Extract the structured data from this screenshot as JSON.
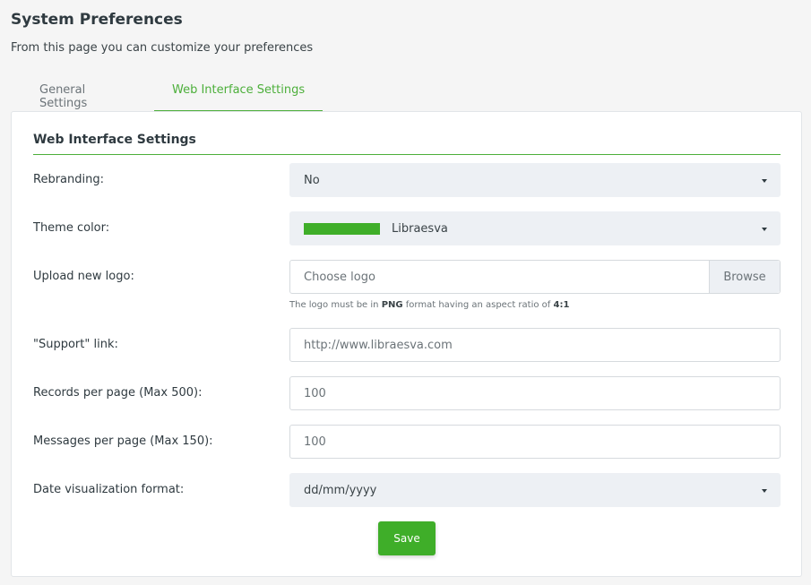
{
  "page": {
    "title": "System Preferences",
    "subtitle": "From this page you can customize your preferences"
  },
  "tabs": [
    {
      "label": "General Settings",
      "active": false
    },
    {
      "label": "Web Interface Settings",
      "active": true
    }
  ],
  "section": {
    "title": "Web Interface Settings"
  },
  "form": {
    "rebranding": {
      "label": "Rebranding:",
      "value": "No"
    },
    "theme_color": {
      "label": "Theme color:",
      "value": "Libraesva",
      "swatch_color": "#3fae29"
    },
    "logo": {
      "label": "Upload new logo:",
      "placeholder": "Choose logo",
      "browse_label": "Browse",
      "help_prefix": "The logo must be in ",
      "help_format": "PNG",
      "help_middle": " format having an aspect ratio of ",
      "help_ratio": "4:1"
    },
    "support_link": {
      "label": "\"Support\" link:",
      "value": "http://www.libraesva.com"
    },
    "records_per_page": {
      "label": "Records per page (Max 500):",
      "value": "100"
    },
    "messages_per_page": {
      "label": "Messages per page (Max 150):",
      "value": "100"
    },
    "date_format": {
      "label": "Date visualization format:",
      "value": "dd/mm/yyyy"
    }
  },
  "actions": {
    "save_label": "Save"
  },
  "colors": {
    "accent": "#4caf3a",
    "button": "#3fae29"
  }
}
